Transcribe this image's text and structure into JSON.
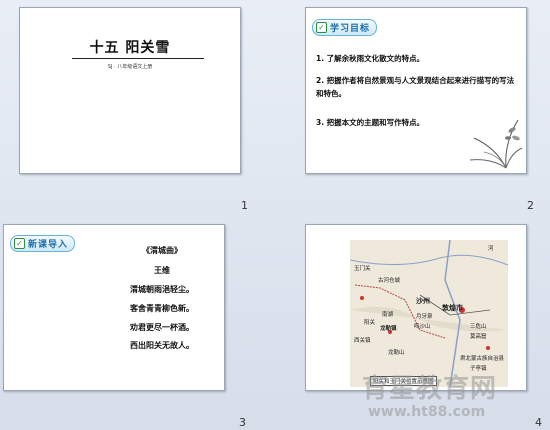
{
  "slides": [
    {
      "number": "1",
      "title": "十五  阳关雪",
      "subtitle": "SJ · 八年级语文上册"
    },
    {
      "number": "2",
      "badge": "学习目标",
      "goals": [
        "1. 了解余秋雨文化散文的特点。",
        "2. 把握作者将自然景观与人文景观结合起来进行描写的写法和特色。",
        "3. 把握本文的主题和写作特点。"
      ]
    },
    {
      "number": "3",
      "badge": "新课导入",
      "poem": {
        "title": "《渭城曲》",
        "author": "王维",
        "lines": [
          "渭城朝雨浥轻尘。",
          "客舍青青柳色新。",
          "劝君更尽一杯酒。",
          "西出阳关无故人。"
        ]
      }
    },
    {
      "number": "4",
      "map": {
        "labels": [
          "玉门关",
          "古河仓城",
          "敦煌市",
          "沙州",
          "月牙泉",
          "鸣沙山",
          "阳关",
          "南湖",
          "龙勒镇",
          "西关镇",
          "三危山",
          "莫高窟",
          "龙勒山",
          "肃北蒙古族自治县",
          "子亭镇",
          "阳关和玉门关位置示意图",
          "河"
        ],
        "caption": "阳关和玉门关位置示意图"
      }
    }
  ],
  "watermark": {
    "main": "育星教育网",
    "url": "www.ht88.com"
  }
}
